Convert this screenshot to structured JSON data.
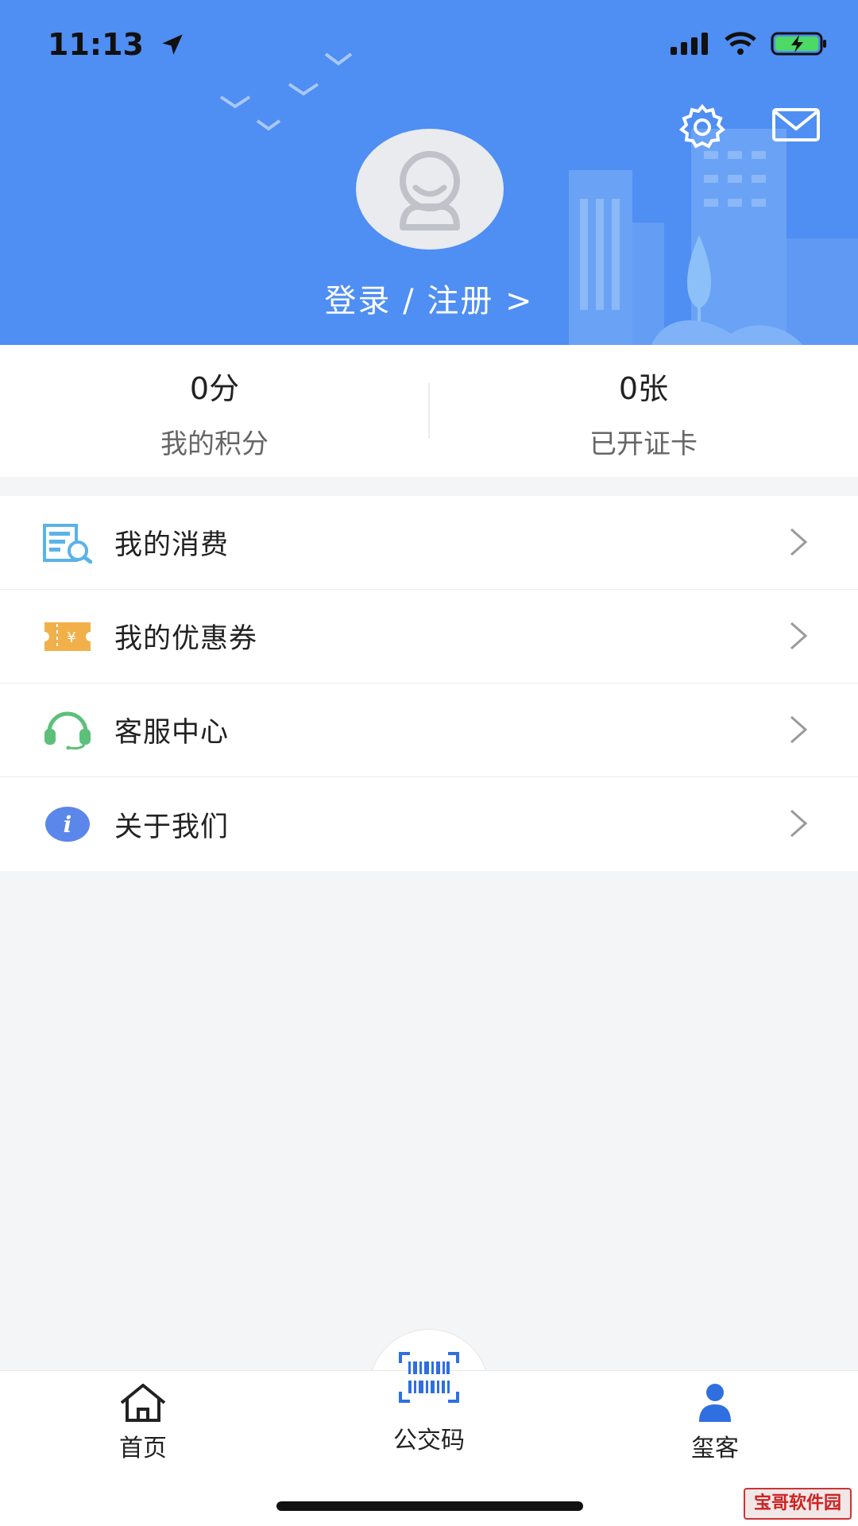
{
  "status_bar": {
    "time": "11:13"
  },
  "header": {
    "login_label": "登录 / 注册 >"
  },
  "stats": [
    {
      "value": "0分",
      "label": "我的积分"
    },
    {
      "value": "0张",
      "label": "已开证卡"
    }
  ],
  "menu": [
    {
      "label": "我的消费",
      "icon": "receipt-icon"
    },
    {
      "label": "我的优惠券",
      "icon": "coupon-icon"
    },
    {
      "label": "客服中心",
      "icon": "headset-icon"
    },
    {
      "label": "关于我们",
      "icon": "info-icon"
    }
  ],
  "bottom_nav": [
    {
      "label": "首页",
      "icon": "home-icon"
    },
    {
      "label": "公交码",
      "icon": "barcode-icon"
    },
    {
      "label": "玺客",
      "icon": "user-icon"
    }
  ],
  "watermark": "宝哥软件园",
  "colors": {
    "header_bg": "#4f8ef3",
    "accent_blue": "#3e7be6",
    "coupon_orange": "#f2b04a",
    "headset_green": "#5cc07a",
    "receipt_blue": "#5ab3e8"
  }
}
